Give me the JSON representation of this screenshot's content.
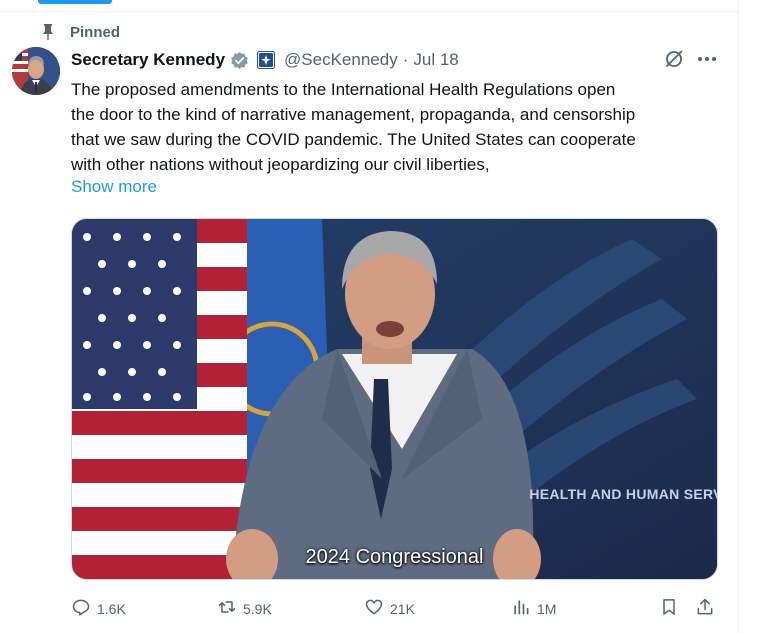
{
  "pinned_label": "Pinned",
  "author": {
    "display_name": "Secretary Kennedy",
    "handle": "@SecKennedy",
    "separator": "·",
    "date": "Jul 18"
  },
  "tweet": {
    "lines": [
      "The proposed amendments to the International Health Regulations open",
      "the door to the kind of narrative management, propaganda, and censorship",
      "that we saw during the COVID pandemic. The United States can cooperate",
      "with other nations without jeopardizing our civil liberties,"
    ],
    "show_more": "Show more"
  },
  "media": {
    "caption": "2024 Congressional",
    "background_text": "HEALTH AND HUMAN SERVI"
  },
  "actions": {
    "replies": "1.6K",
    "reposts": "5.9K",
    "likes": "21K",
    "views": "1M"
  },
  "colors": {
    "accent": "#1d9bf0",
    "secondary_text": "#536471",
    "verified_badge": "#829aab"
  },
  "icons": [
    "pin-icon",
    "verified-badge-icon",
    "government-affiliation-icon",
    "grok-icon",
    "more-icon",
    "reply-icon",
    "repost-icon",
    "like-icon",
    "views-icon",
    "bookmark-icon",
    "share-icon"
  ]
}
